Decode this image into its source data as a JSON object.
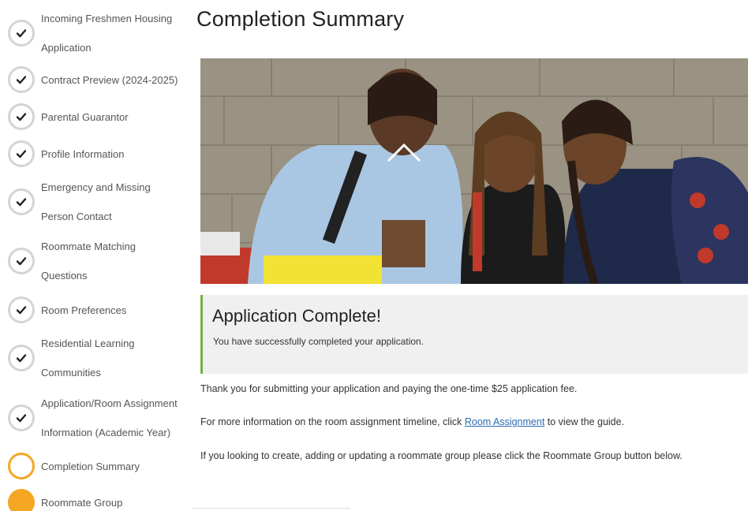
{
  "sidebar": {
    "steps": [
      {
        "label_line1": "Incoming Freshmen Housing",
        "label_line2": "Application",
        "status": "complete"
      },
      {
        "label_line1": "Contract Preview (2024-2025)",
        "label_line2": "",
        "status": "complete"
      },
      {
        "label_line1": "Parental Guarantor",
        "label_line2": "",
        "status": "complete"
      },
      {
        "label_line1": "Profile Information",
        "label_line2": "",
        "status": "complete"
      },
      {
        "label_line1": "Emergency and Missing",
        "label_line2": "Person Contact",
        "status": "complete"
      },
      {
        "label_line1": "Roommate Matching",
        "label_line2": "Questions",
        "status": "complete"
      },
      {
        "label_line1": "Room Preferences",
        "label_line2": "",
        "status": "complete"
      },
      {
        "label_line1": "Residential Learning",
        "label_line2": "Communities",
        "status": "complete"
      },
      {
        "label_line1": "Application/Room Assignment",
        "label_line2": "Information (Academic Year)",
        "status": "complete"
      },
      {
        "label_line1": "Completion Summary",
        "label_line2": "",
        "status": "current"
      },
      {
        "label_line1": "Roommate Group",
        "label_line2": "",
        "status": "future"
      }
    ]
  },
  "main": {
    "title": "Completion Summary",
    "panel": {
      "title": "Application Complete!",
      "text": "You have successfully completed your application."
    },
    "para1": "Thank you for submitting your application and paying the one-time $25 application fee.",
    "para2_before": "For more information on the room assignment timeline, click ",
    "para2_link": "Room Assignment",
    "para2_after": " to view the guide.",
    "para3": "If you looking to create, adding or updating a roommate group please click the Roommate Group button below."
  },
  "colors": {
    "complete_border": "#d4d4d4",
    "current_accent": "#f5a623",
    "panel_accent": "#6db33f",
    "link": "#2a6db5"
  },
  "icons": {
    "complete": "check-icon",
    "current": "ring-icon",
    "future": "filled-circle-icon"
  }
}
